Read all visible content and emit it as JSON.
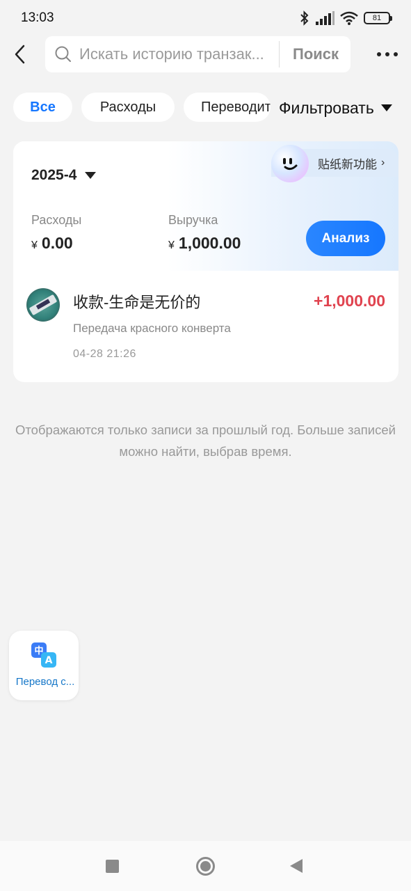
{
  "status_bar": {
    "time": "13:03",
    "battery": "81"
  },
  "top_bar": {
    "search_placeholder": "Искать историю транзак...",
    "search_button": "Поиск"
  },
  "filters": {
    "chips": [
      "Все",
      "Расходы",
      "Переводить"
    ],
    "active": "Все",
    "filter_label": "Фильтровать"
  },
  "card": {
    "sticker_banner": "贴纸新功能",
    "month": "2025-4",
    "expenses": {
      "label": "Расходы",
      "currency": "¥",
      "value": "0.00"
    },
    "revenue": {
      "label": "Выручка",
      "currency": "¥",
      "value": "1,000.00"
    },
    "analyze_button": "Анализ",
    "transactions": [
      {
        "title": "收款-生命是无价的",
        "subtitle": "Передача красного конверта",
        "time": "04-28 21:26",
        "amount": "+1,000.00"
      }
    ]
  },
  "footer_note": "Отображаются только записи за прошлый год. Больше записей можно найти, выбрав время.",
  "float_widget": {
    "label": "Перевод с..."
  },
  "colors": {
    "accent": "#1677ff",
    "income": "#e0434f",
    "background": "#f3f3f3"
  }
}
